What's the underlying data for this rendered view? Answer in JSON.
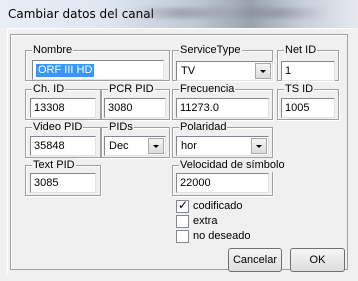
{
  "window": {
    "title": "Cambiar datos del canal"
  },
  "fields": {
    "nombre": {
      "label": "Nombre",
      "value": "ORF III HD"
    },
    "service_type": {
      "label": "ServiceType",
      "value": "TV"
    },
    "net_id": {
      "label": "Net ID",
      "value": "1"
    },
    "ch_id": {
      "label": "Ch. ID",
      "value": "13308"
    },
    "pcr_pid": {
      "label": "PCR PID",
      "value": "3080"
    },
    "frecuencia": {
      "label": "Frecuencia",
      "value": "11273.0"
    },
    "ts_id": {
      "label": "TS ID",
      "value": "1005"
    },
    "video_pid": {
      "label": "Video PID",
      "value": "35848"
    },
    "pids": {
      "label": "PIDs",
      "value": "Dec"
    },
    "polaridad": {
      "label": "Polaridad",
      "value": "hor"
    },
    "text_pid": {
      "label": "Text PID",
      "value": "3085"
    },
    "velocidad": {
      "label": "Velocidad de símbolo",
      "value": "22000"
    }
  },
  "checkboxes": [
    {
      "label": "codificado",
      "checked": true
    },
    {
      "label": "extra",
      "checked": false
    },
    {
      "label": "no deseado",
      "checked": false
    }
  ],
  "buttons": {
    "cancel": "Cancelar",
    "ok": "OK"
  }
}
